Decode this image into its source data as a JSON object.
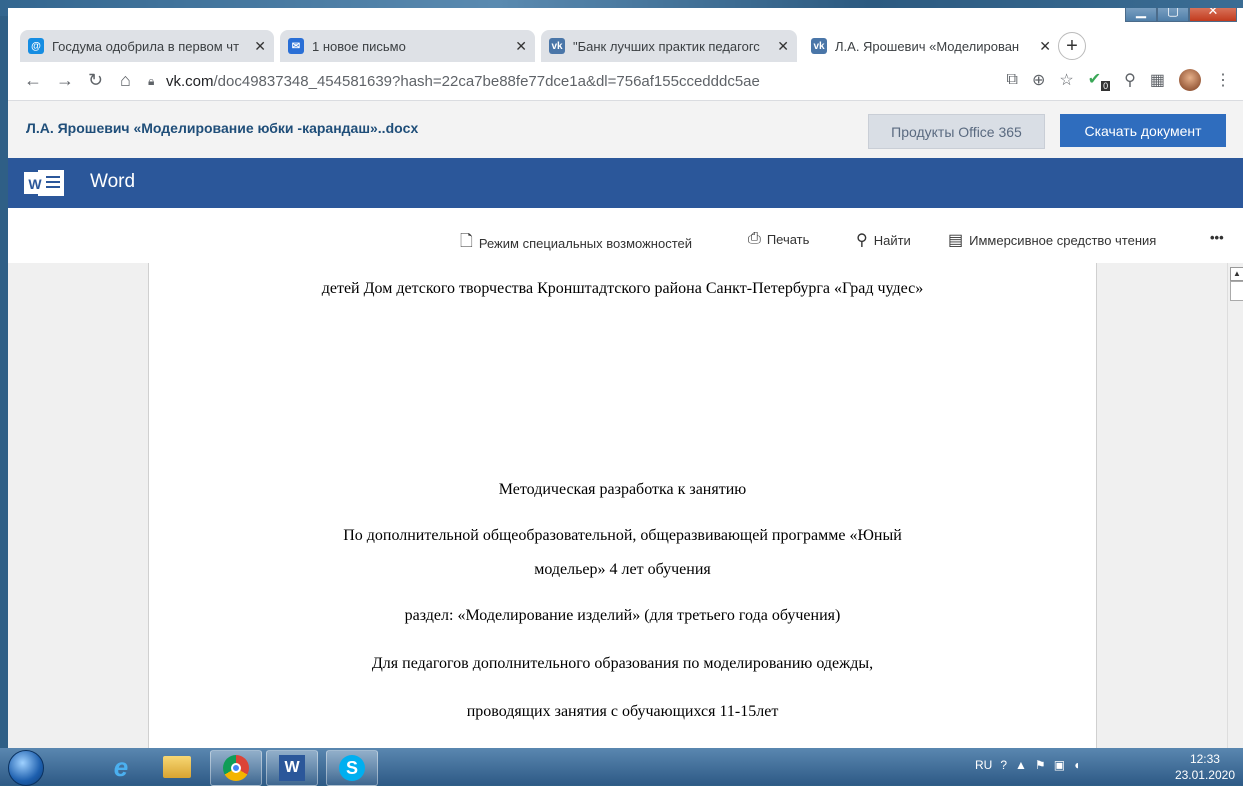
{
  "tabs": [
    {
      "title": "Госдума одобрила в первом чт",
      "favicon": "mail-ru-icon",
      "color": "#168de2"
    },
    {
      "title": "1 новое письмо",
      "favicon": "mail-envelope-icon",
      "color": "#2a6fd6"
    },
    {
      "title": "\"Банк лучших практик педагогс",
      "favicon": "vk-icon",
      "color": "#4a76a8"
    },
    {
      "title": "Л.А. Ярошевич «Моделирован",
      "favicon": "vk-icon",
      "color": "#4a76a8"
    }
  ],
  "address": {
    "host": "vk.com",
    "path": "/doc49837348_454581639?hash=22ca7be88fe77dce1a&dl=756af155ccedddc5ae"
  },
  "office": {
    "doc_title": "Л.А. Ярошевич «Моделирование юбки -карандаш»..docx",
    "office_button": "Продукты Office 365",
    "download_button": "Скачать документ"
  },
  "word": {
    "app_name": "Word"
  },
  "ribbon": {
    "accessibility": "Режим специальных возможностей",
    "print": "Печать",
    "find": "Найти",
    "immersive": "Иммерсивное средство чтения",
    "more": "•••"
  },
  "document": {
    "lines": [
      "детей Дом детского творчества Кронштадтского района Санкт-Петербурга «Град чудес»",
      "Методическая разработка к занятию",
      "По дополнительной общеобразовательной, общеразвивающей программе «Юный",
      "модельер» 4 лет обучения",
      "раздел: «Моделирование изделий» (для третьего года обучения)",
      "Для педагогов дополнительного образования по моделированию одежды,",
      "проводящих занятия с обучающихся 11-15лет"
    ]
  },
  "taskbar": {
    "lang": "RU",
    "time": "12:33",
    "date": "23.01.2020"
  },
  "extension_badge": "0"
}
